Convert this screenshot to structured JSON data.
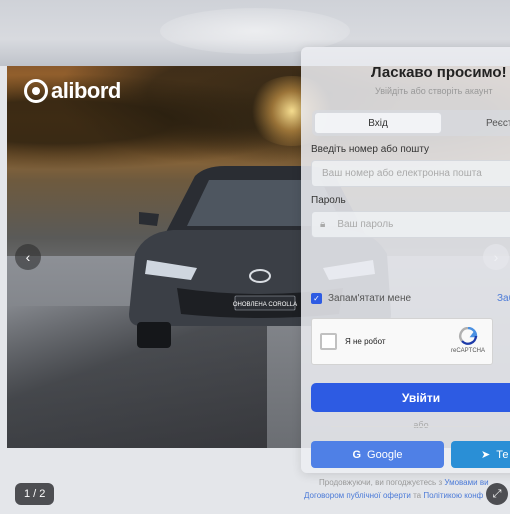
{
  "brand": {
    "name": "alibord"
  },
  "gallery": {
    "counter": "1 / 2",
    "prev_icon": "chevron-left-icon",
    "next_icon": "chevron-right-icon",
    "expand_icon": "expand-icon",
    "plate_text": "ОНОВЛЕНА COROLLA"
  },
  "login": {
    "title": "Ласкаво просимо!",
    "subtitle": "Увійдіть або створіть акаунт",
    "tabs": [
      {
        "label": "Вхід"
      },
      {
        "label": "Реєстр"
      }
    ],
    "identifier_label": "Введіть номер або пошту",
    "identifier_placeholder": "Ваш номер або електронна пошта",
    "password_label": "Пароль",
    "password_placeholder": "Ваш пароль",
    "remember_label": "Запам'ятати мене",
    "forgot_label": "Заб",
    "captcha_label": "Я не робот",
    "captcha_brand": "reCAPTCHA",
    "submit_label": "Увійти",
    "or_label": "або",
    "google_label": "Google",
    "telegram_label": "Те",
    "terms_prefix": "Продовжуючи, ви погоджуєтесь з",
    "terms_link1": "Умовами ви",
    "terms_link2": "Договором публічної оферти",
    "terms_mid": "та",
    "terms_link3": "Політикою конф"
  },
  "colors": {
    "primary": "#2d5be3",
    "google": "#4f80e6",
    "telegram": "#2a8fd6",
    "link": "#4c7bd8"
  }
}
